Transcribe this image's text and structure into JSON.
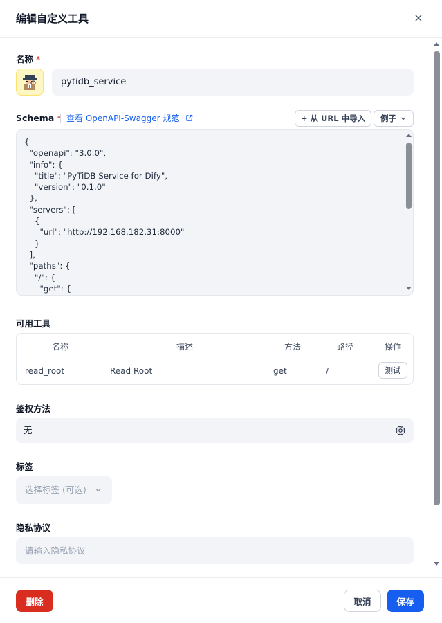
{
  "dialog": {
    "title": "编辑自定义工具",
    "close_glyph": "×"
  },
  "name_field": {
    "label": "名称",
    "required_mark": "*",
    "value": "pytidb_service",
    "emoji_icon": "spy-detective-emoji"
  },
  "schema": {
    "label": "Schema",
    "required_mark": "*",
    "swagger_link": "查看 OpenAPI-Swagger 规范",
    "import_button": "+ 从 URL 中导入",
    "example_button": "例子",
    "code": "{\n  \"openapi\": \"3.0.0\",\n  \"info\": {\n    \"title\": \"PyTiDB Service for Dify\",\n    \"version\": \"0.1.0\"\n  },\n  \"servers\": [\n    {\n      \"url\": \"http://192.168.182.31:8000\"\n    }\n  ],\n  \"paths\": {\n    \"/\": {\n      \"get\": {\n        \"summary\": \"Read Root\","
  },
  "tools": {
    "label": "可用工具",
    "columns": [
      "名称",
      "描述",
      "方法",
      "路径",
      "操作"
    ],
    "rows": [
      {
        "name": "read_root",
        "description": "Read Root",
        "method": "get",
        "path": "/",
        "action": "测试"
      }
    ]
  },
  "auth": {
    "label": "鉴权方法",
    "value": "无"
  },
  "tags": {
    "label": "标签",
    "placeholder": "选择标签 (可选)"
  },
  "privacy": {
    "label": "隐私协议",
    "placeholder": "请输入隐私协议"
  },
  "footer": {
    "delete": "删除",
    "cancel": "取消",
    "save": "保存"
  },
  "colors": {
    "primary": "#155eef",
    "danger": "#d92d20",
    "field_bg": "#f2f4f7"
  }
}
